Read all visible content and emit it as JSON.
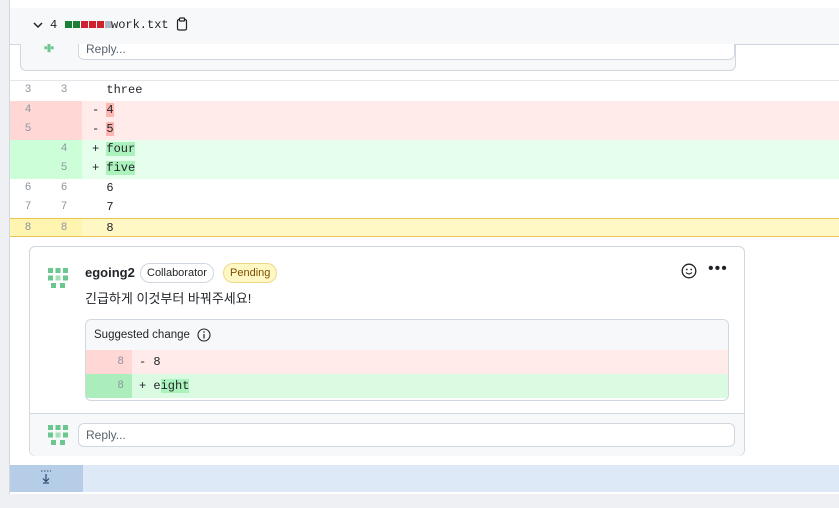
{
  "file_header": {
    "changes_count": "4",
    "diffstat": [
      "#1a7f37",
      "#1a7f37",
      "#cf222e",
      "#cf222e",
      "#cf222e",
      "#afb8c1"
    ],
    "filename": "work.txt",
    "icons": {
      "collapse": "chevron-down-icon",
      "copy": "copy-icon"
    }
  },
  "previous_thread": {
    "reply_placeholder": "Reply..."
  },
  "diff_rows": [
    {
      "type": "context",
      "old": "3",
      "new": "3",
      "sign": " ",
      "text": "three",
      "hl": ""
    },
    {
      "type": "del",
      "old": "4",
      "new": "",
      "sign": "-",
      "text": "",
      "hl": "4"
    },
    {
      "type": "del",
      "old": "5",
      "new": "",
      "sign": "-",
      "text": "",
      "hl": "5"
    },
    {
      "type": "add",
      "old": "",
      "new": "4",
      "sign": "+",
      "text": "",
      "hl": "four"
    },
    {
      "type": "add",
      "old": "",
      "new": "5",
      "sign": "+",
      "text": "",
      "hl": "five"
    },
    {
      "type": "context",
      "old": "6",
      "new": "6",
      "sign": " ",
      "text": "6",
      "hl": ""
    },
    {
      "type": "context",
      "old": "7",
      "new": "7",
      "sign": " ",
      "text": "7",
      "hl": ""
    },
    {
      "type": "sel",
      "old": "8",
      "new": "8",
      "sign": " ",
      "text": "8",
      "hl": ""
    }
  ],
  "comment": {
    "author": "egoing2",
    "role_badge": "Collaborator",
    "status_badge": "Pending",
    "body": "긴급하게 이것부터 바꿔주세요!",
    "icons": {
      "reaction": "smiley-icon",
      "menu": "kebab-menu-icon"
    },
    "suggestion": {
      "title": "Suggested change",
      "del_line_no": "8",
      "del_text": "- 8",
      "add_line_no": "8",
      "add_prefix": "+ e",
      "add_hl": "ight"
    },
    "reply_placeholder": "Reply..."
  },
  "footer": {
    "expand_icon": "expand-down-icon"
  }
}
